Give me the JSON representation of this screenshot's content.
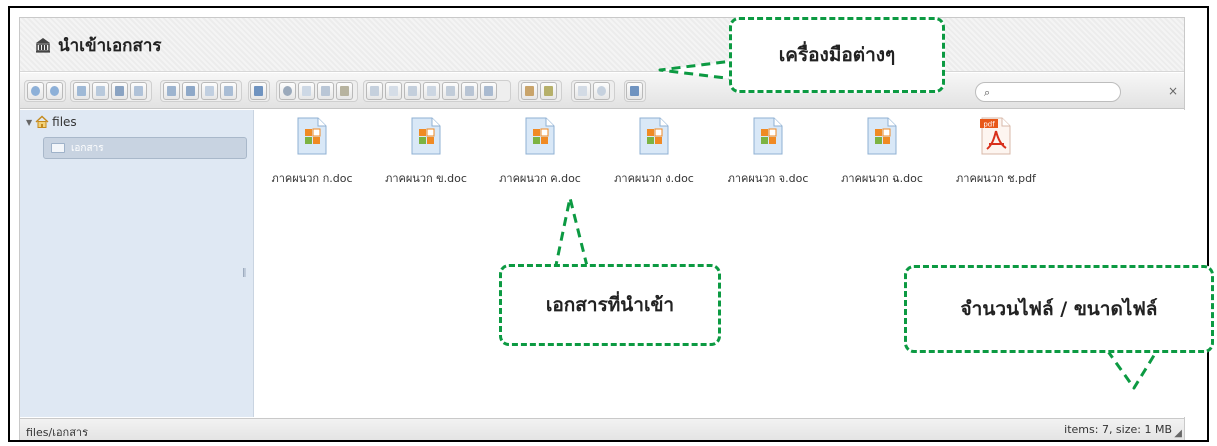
{
  "window": {
    "title": "นำเข้าเอกสาร",
    "title_icon": "building-icon"
  },
  "toolbar": {
    "search": {
      "value": "",
      "placeholder": ""
    },
    "close_label": "×"
  },
  "sidebar": {
    "root_label": "files",
    "folder_label": "เอกสาร"
  },
  "files": [
    {
      "name": "ภาคผนวก ก.doc",
      "type": "doc"
    },
    {
      "name": "ภาคผนวก ข.doc",
      "type": "doc"
    },
    {
      "name": "ภาคผนวก ค.doc",
      "type": "doc"
    },
    {
      "name": "ภาคผนวก ง.doc",
      "type": "doc"
    },
    {
      "name": "ภาคผนวก จ.doc",
      "type": "doc"
    },
    {
      "name": "ภาคผนวก ฉ.doc",
      "type": "doc"
    },
    {
      "name": "ภาคผนวก ช.pdf",
      "type": "pdf",
      "badge": "pdf"
    }
  ],
  "statusbar": {
    "path": "files/เอกสาร",
    "info": "items: 7, size: 1 MB"
  },
  "callouts": {
    "tools": "เครื่องมือต่างๆ",
    "imported": "เอกสารที่นำเข้า",
    "count": "จำนวนไฟล์ / ขนาดไฟล์"
  },
  "colors": {
    "callout_border": "#0c9a42",
    "sidebar": "#dfe8f3"
  }
}
